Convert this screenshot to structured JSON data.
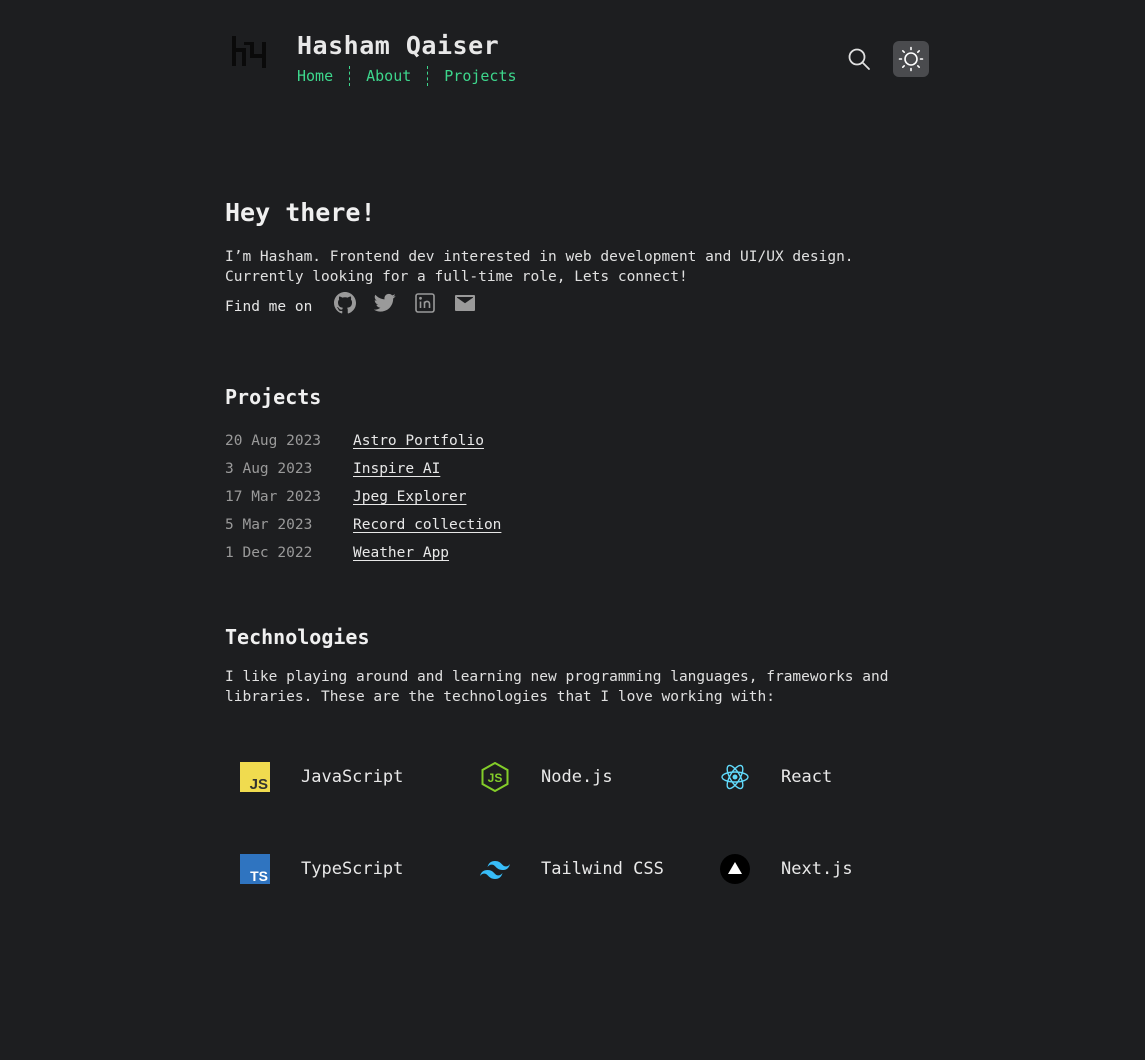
{
  "header": {
    "title": "Hasham Qaiser",
    "logo_icon": "hq-logo-icon",
    "nav": [
      {
        "label": "Home"
      },
      {
        "label": "About"
      },
      {
        "label": "Projects"
      }
    ],
    "search_icon": "search-icon",
    "theme_icon": "sun-icon"
  },
  "intro": {
    "heading": "Hey there!",
    "text": "I’m Hasham. Frontend dev interested in web development and UI/UX design. Currently looking for a full-time role, Lets connect!",
    "find_label": "Find me on",
    "social": [
      "github-icon",
      "twitter-icon",
      "linkedin-icon",
      "mail-icon"
    ]
  },
  "projects": {
    "heading": "Projects",
    "items": [
      {
        "date": "20 Aug 2023",
        "name": "Astro Portfolio"
      },
      {
        "date": "3 Aug 2023",
        "name": "Inspire AI"
      },
      {
        "date": "17 Mar 2023",
        "name": "Jpeg Explorer"
      },
      {
        "date": "5 Mar 2023",
        "name": "Record collection"
      },
      {
        "date": "1 Dec 2022",
        "name": "Weather App"
      }
    ]
  },
  "technologies": {
    "heading": "Technologies",
    "text": "I like playing around and learning new programming languages, frameworks and libraries. These are the technologies that I love working with:",
    "items": [
      {
        "name": "JavaScript",
        "icon": "javascript-icon"
      },
      {
        "name": "Node.js",
        "icon": "nodejs-icon"
      },
      {
        "name": "React",
        "icon": "react-icon"
      },
      {
        "name": "TypeScript",
        "icon": "typescript-icon"
      },
      {
        "name": "Tailwind CSS",
        "icon": "tailwind-icon"
      },
      {
        "name": "Next.js",
        "icon": "nextjs-icon"
      }
    ]
  },
  "colors": {
    "background": "#1d1e20",
    "accent": "#3dd68c",
    "muted": "#9a9a9a"
  }
}
